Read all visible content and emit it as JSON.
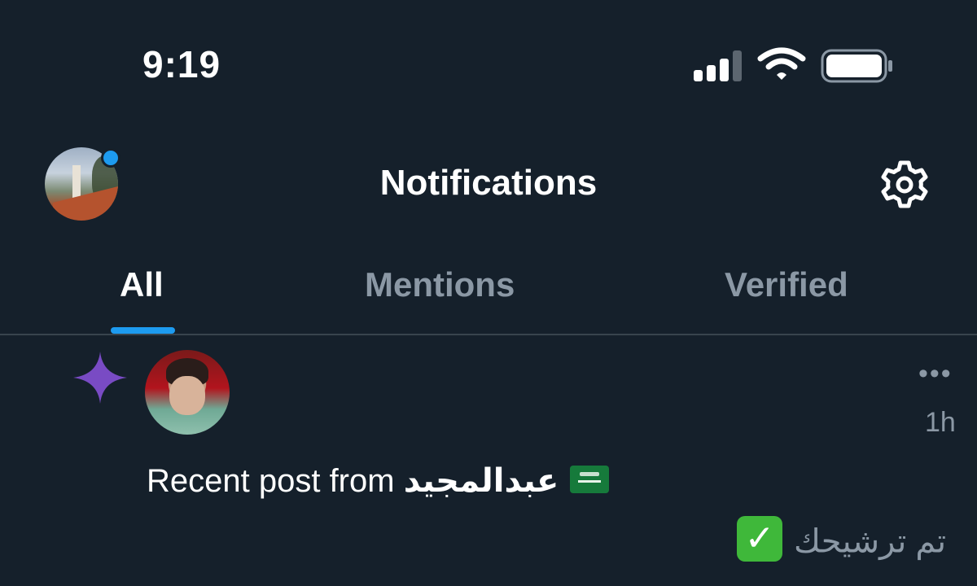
{
  "status_bar": {
    "time": "9:19"
  },
  "header": {
    "title": "Notifications",
    "avatar_icon": "profile-avatar",
    "settings_icon": "gear-icon"
  },
  "tabs": [
    {
      "label": "All",
      "active": true
    },
    {
      "label": "Mentions",
      "active": false
    },
    {
      "label": "Verified",
      "active": false
    }
  ],
  "notification": {
    "icon": "sparkle-icon",
    "text_prefix": "Recent post from",
    "user_name": "عبدالمجيد",
    "flag_icon": "saudi-flag",
    "time_ago": "1h",
    "more_label": "•••",
    "preview_text": "تم ترشيحك",
    "check_mark": "✓"
  },
  "colors": {
    "background": "#15202b",
    "accent": "#1d9bf0",
    "muted": "#8b98a5",
    "sparkle": "#794bc4",
    "divider": "#38444d"
  }
}
